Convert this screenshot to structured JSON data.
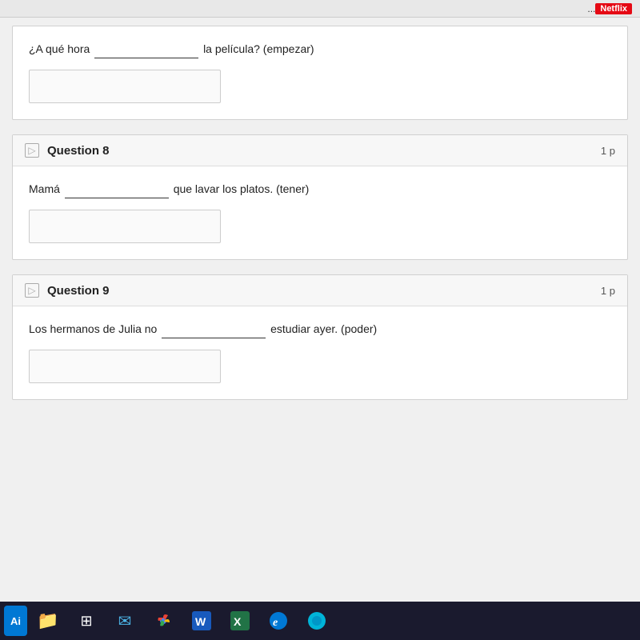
{
  "topbar": {
    "netflix_label": "Netflix"
  },
  "partial_question": {
    "text_before": "¿A qué hora",
    "blank": "________________",
    "text_after": "la película? (empezar)"
  },
  "questions": [
    {
      "id": "q8",
      "title": "Question 8",
      "points": "1 p",
      "text_before": "Mamá",
      "blank": "________________",
      "text_after": "que lavar los platos.  (tener)"
    },
    {
      "id": "q9",
      "title": "Question 9",
      "points": "1 p",
      "text_before": "Los hermanos de Julia no",
      "blank": "________________",
      "text_after": "estudiar ayer.  (poder)"
    }
  ],
  "taskbar": {
    "start_label": "Ai",
    "apps": [
      {
        "name": "file-explorer",
        "icon": "📁"
      },
      {
        "name": "start-menu",
        "icon": "⊞"
      },
      {
        "name": "mail",
        "icon": "✉"
      },
      {
        "name": "chrome",
        "icon": "🌐"
      },
      {
        "name": "word",
        "icon": "W"
      },
      {
        "name": "excel",
        "icon": "X"
      },
      {
        "name": "edge",
        "icon": "e"
      },
      {
        "name": "app8",
        "icon": "🔵"
      }
    ]
  }
}
